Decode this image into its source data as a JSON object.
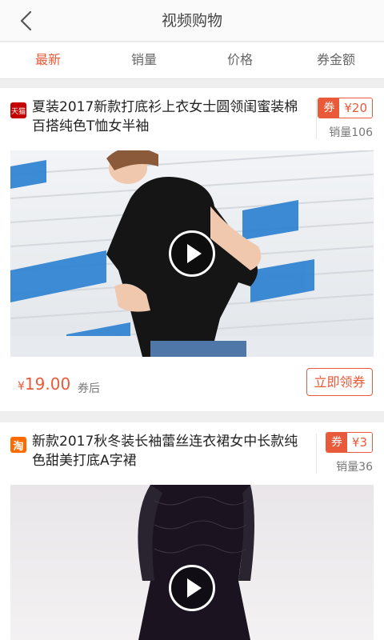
{
  "header": {
    "title": "视频购物",
    "back_icon": "chevron-left-icon"
  },
  "tabs": [
    {
      "label": "最新",
      "active": true
    },
    {
      "label": "销量"
    },
    {
      "label": "价格"
    },
    {
      "label": "券金额"
    }
  ],
  "products": [
    {
      "platform": "天猫",
      "platform_icon": "tmall-icon",
      "title": "夏装2017新款打底衫上衣女士圆领闺蜜装棉百搭纯色T恤女半袖",
      "coupon_tag": "券",
      "coupon_value": "¥20",
      "sales": "销量106",
      "price_symbol": "¥",
      "price": "19.00",
      "price_note": "券后",
      "get_button": "立即领券",
      "media_icon": "play-icon"
    },
    {
      "platform": "淘",
      "platform_icon": "taobao-icon",
      "title": "新款2017秋冬装长袖蕾丝连衣裙女中长款纯色甜美打底A字裙",
      "coupon_tag": "券",
      "coupon_value": "¥3",
      "sales": "销量36",
      "media_icon": "play-icon"
    }
  ],
  "colors": {
    "accent": "#e85a3a",
    "tmall": "#c40000",
    "taobao": "#ff6a00"
  }
}
